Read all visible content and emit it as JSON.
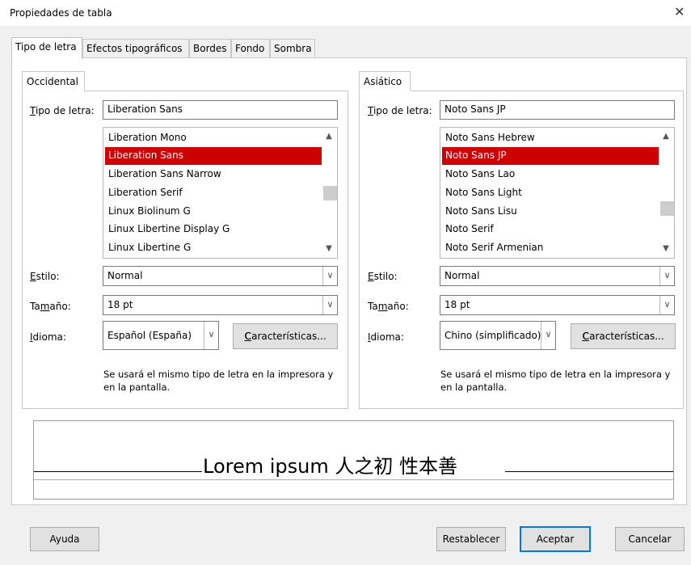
{
  "window": {
    "title": "Propiedades de tabla",
    "close_glyph": "✕"
  },
  "tabs": [
    {
      "label": "Tipo de letra",
      "active": true
    },
    {
      "label": "Efectos tipográficos"
    },
    {
      "label": "Bordes"
    },
    {
      "label": "Fondo"
    },
    {
      "label": "Sombra"
    }
  ],
  "western": {
    "tab": "Occidental",
    "font_label": "Tipo de letra:",
    "font_value": "Liberation Sans",
    "font_list": [
      "Liberation Mono",
      "Liberation Sans",
      "Liberation Sans Narrow",
      "Liberation Serif",
      "Linux Biolinum G",
      "Linux Libertine Display G",
      "Linux Libertine G"
    ],
    "selected_index": 1,
    "style_label": "Estilo:",
    "style_value": "Normal",
    "size_label": "Tamaño:",
    "size_value": "18 pt",
    "language_label": "Idioma:",
    "language_value": "Español (España)",
    "features_button": "Características...",
    "note": "Se usará el mismo tipo de letra en la impresora y en la pantalla."
  },
  "asian": {
    "tab": "Asiático",
    "font_label": "Tipo de letra:",
    "font_value": "Noto Sans JP",
    "font_list": [
      "Noto Sans Hebrew",
      "Noto Sans JP",
      "Noto Sans Lao",
      "Noto Sans Light",
      "Noto Sans Lisu",
      "Noto Serif",
      "Noto Serif Armenian"
    ],
    "selected_index": 1,
    "style_label": "Estilo:",
    "style_value": "Normal",
    "size_label": "Tamaño:",
    "size_value": "18 pt",
    "language_label": "Idioma:",
    "language_value": "Chino (simplificado)",
    "features_button": "Características...",
    "note": "Se usará el mismo tipo de letra en la impresora y en la pantalla."
  },
  "preview": {
    "text": "Lorem ipsum   人之初 性本善"
  },
  "buttons": {
    "help": "Ayuda",
    "reset": "Restablecer",
    "ok": "Aceptar",
    "cancel": "Cancelar"
  },
  "colors": {
    "selection": "#cc0000",
    "default_button_border": "#0078d7"
  }
}
